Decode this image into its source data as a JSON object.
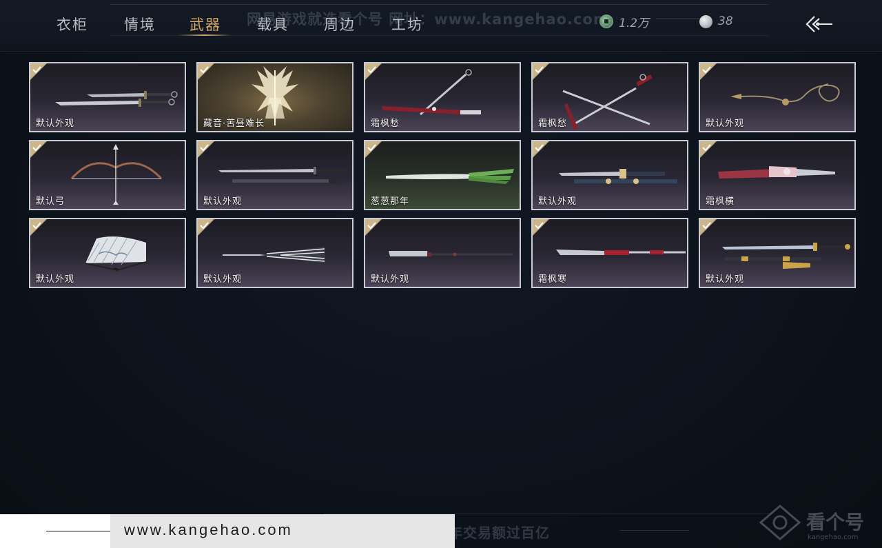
{
  "tabs": [
    {
      "label": "衣柜",
      "active": false
    },
    {
      "label": "情境",
      "active": false
    },
    {
      "label": "武器",
      "active": true
    },
    {
      "label": "载具",
      "active": false
    },
    {
      "label": "周边",
      "active": false
    },
    {
      "label": "工坊",
      "active": false
    }
  ],
  "currency": {
    "jade": {
      "icon": "jade-coin-icon",
      "value": "1.2万"
    },
    "silver": {
      "icon": "silver-coin-icon",
      "value": "38"
    }
  },
  "watermark": {
    "top": "网易游戏就选看个号  网址：www.kangehao.com",
    "bottom": "看个号专业网易游戏八年  年交易额过百亿",
    "url": "www.kangehao.com",
    "logo": "看个号",
    "logo_sub": "kangehao.com"
  },
  "weapons": [
    {
      "label": "默认外观",
      "icon": "twin-dao-swords-icon",
      "owned": true
    },
    {
      "label": "藏音·苦昼难长",
      "icon": "winged-ornament-weapon-icon",
      "owned": true
    },
    {
      "label": "霜枫愁",
      "icon": "red-scabbard-sword-icon",
      "owned": true
    },
    {
      "label": "霜枫愁",
      "icon": "crossed-swords-icon",
      "owned": true
    },
    {
      "label": "默认外观",
      "icon": "rope-dart-icon",
      "owned": true
    },
    {
      "label": "默认弓",
      "icon": "bow-icon",
      "owned": true
    },
    {
      "label": "默认外观",
      "icon": "sword-and-scabbard-icon",
      "owned": true
    },
    {
      "label": "葱葱那年",
      "icon": "scallion-sword-icon",
      "owned": true
    },
    {
      "label": "默认外观",
      "icon": "ornate-blue-sword-icon",
      "owned": true
    },
    {
      "label": "霜枫横",
      "icon": "pink-scabbard-sword-icon",
      "owned": true
    },
    {
      "label": "默认外观",
      "icon": "folding-fan-icon",
      "owned": true
    },
    {
      "label": "默认外观",
      "icon": "umbrella-spear-icon",
      "owned": true
    },
    {
      "label": "默认外观",
      "icon": "long-glaive-icon",
      "owned": true
    },
    {
      "label": "霜枫寒",
      "icon": "red-glaive-icon",
      "owned": true
    },
    {
      "label": "默认外观",
      "icon": "golden-sword-icon",
      "owned": true
    }
  ]
}
